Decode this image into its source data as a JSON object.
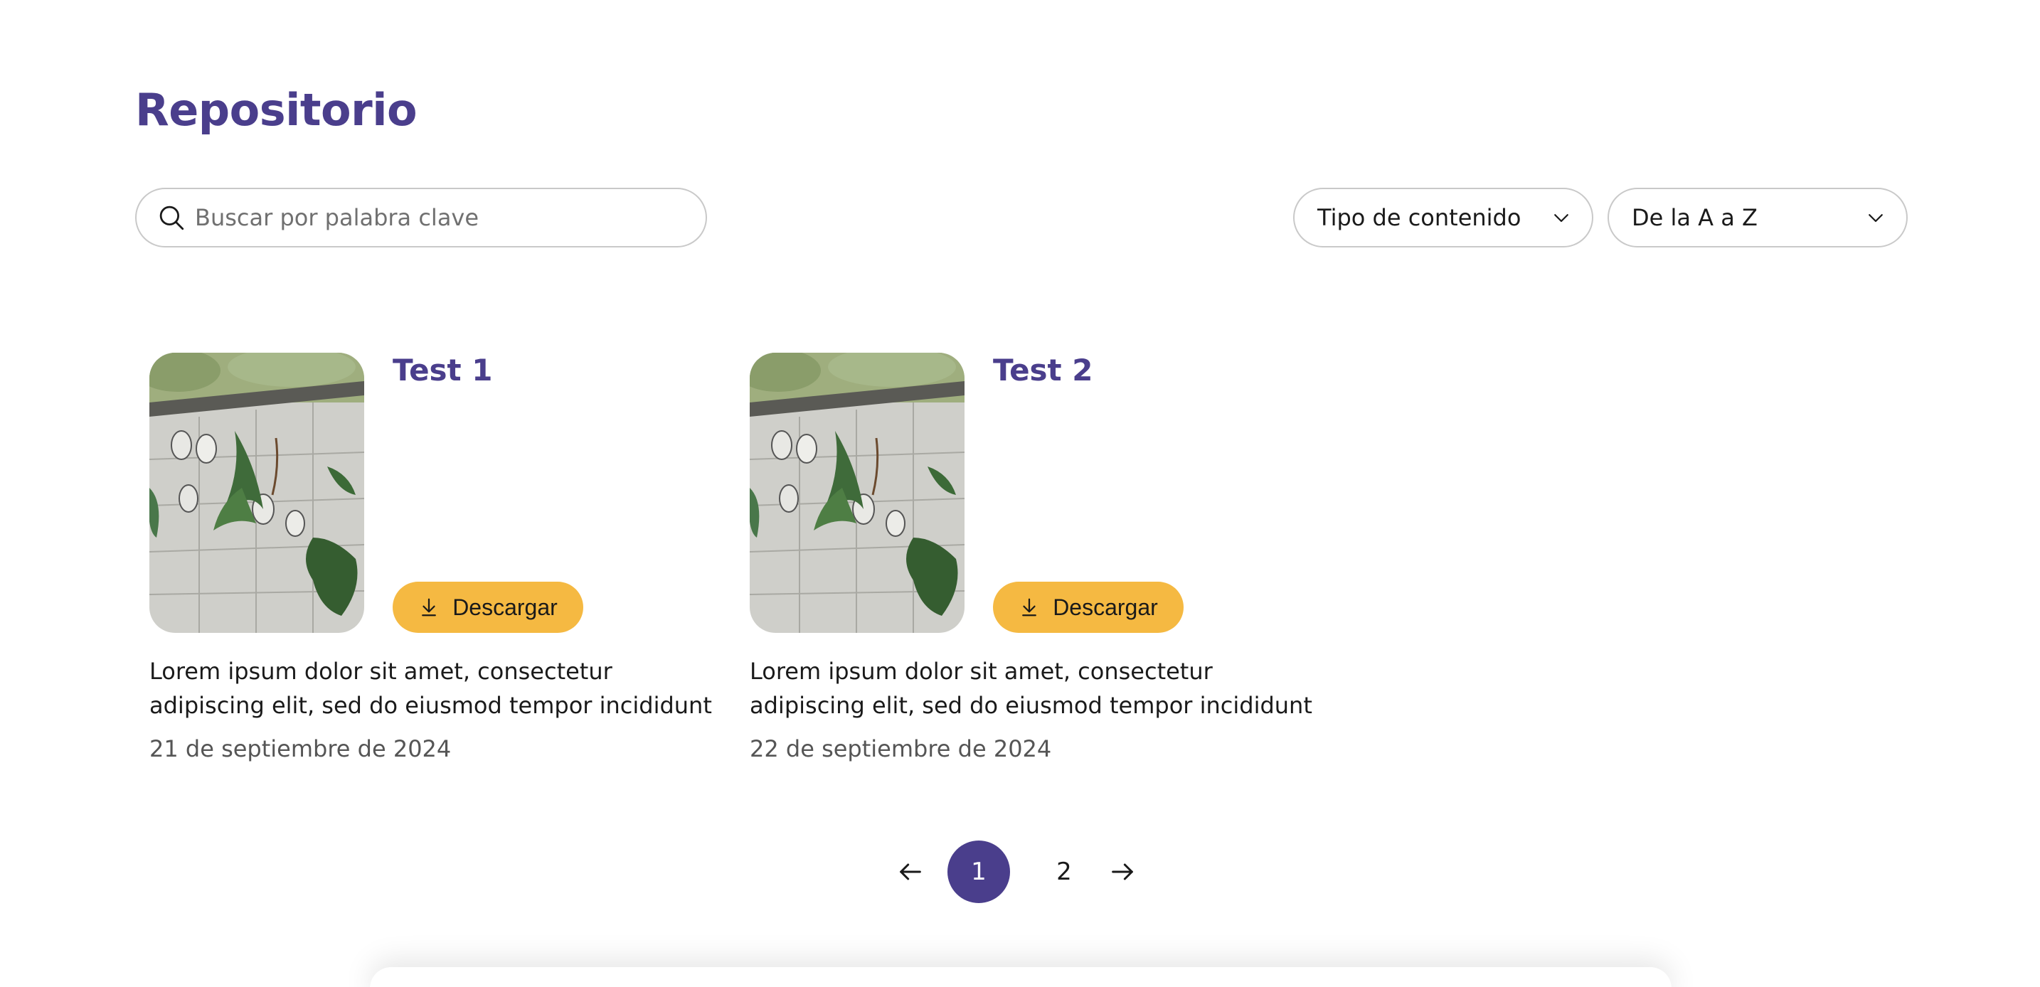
{
  "page": {
    "title": "Repositorio"
  },
  "search": {
    "placeholder": "Buscar por palabra clave",
    "icon": "search-icon"
  },
  "filters": {
    "content_type": {
      "selected": "Tipo de contenido",
      "icon": "chevron-down-icon"
    },
    "sort": {
      "selected": "De la A a Z",
      "icon": "chevron-down-icon"
    }
  },
  "cards": [
    {
      "title": "Test 1",
      "download_label": "Descargar",
      "description": "Lorem ipsum dolor sit amet, consectetur adipiscing elit, sed do eiusmod tempor incididunt",
      "date": "21 de septiembre de 2024"
    },
    {
      "title": "Test 2",
      "download_label": "Descargar",
      "description": "Lorem ipsum dolor sit amet, consectetur adipiscing elit, sed do eiusmod tempor incididunt",
      "date": "22 de septiembre de 2024"
    }
  ],
  "pagination": {
    "pages": [
      "1",
      "2"
    ],
    "current": "1"
  },
  "colors": {
    "accent": "#4a3e8c",
    "button": "#f5b942",
    "border": "#c9c9c9"
  }
}
